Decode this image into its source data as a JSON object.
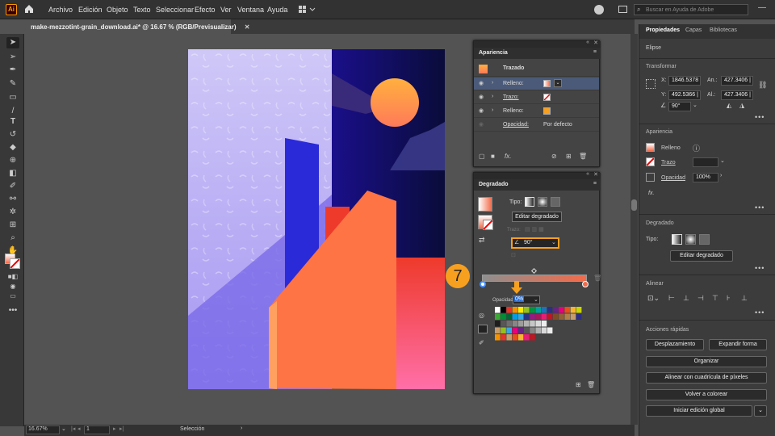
{
  "app": {
    "logo": "Ai"
  },
  "menu": [
    "Archivo",
    "Edición",
    "Objeto",
    "Texto",
    "Seleccionar",
    "Efecto",
    "Ver",
    "Ventana",
    "Ayuda"
  ],
  "search": {
    "placeholder": "Buscar en Ayuda de Adobe"
  },
  "document": {
    "tab_title": "make-mezzotint-grain_download.ai* @ 16.67 % (RGB/Previsualizar)"
  },
  "status": {
    "zoom": "16.67%",
    "artboard": "1",
    "tool": "Selección"
  },
  "right_panel": {
    "tabs": [
      "Propiedades",
      "Capas",
      "Bibliotecas"
    ],
    "object_type": "Elipse",
    "transform": {
      "title": "Transformar",
      "x_label": "X:",
      "x": "1846.5378",
      "y_label": "Y:",
      "y": "492.5366 |",
      "w_label": "An.:",
      "w": "427.3406 |",
      "h_label": "Al.:",
      "h": "427.3406 |",
      "angle": "90°"
    },
    "appearance": {
      "title": "Apariencia",
      "fill": "Relleno",
      "stroke": "Trazo",
      "opacity_label": "Opacidad",
      "opacity": "100%",
      "fx": "fx."
    },
    "gradient": {
      "title": "Degradado",
      "type_label": "Tipo:",
      "edit_button": "Editar degradado"
    },
    "align": {
      "title": "Alinear"
    },
    "quick_actions": {
      "title": "Acciones rápidas",
      "buttons": [
        "Desplazamiento",
        "Expandir forma",
        "Organizar",
        "Alinear con cuadrícula de píxeles",
        "Volver a colorear",
        "Iniciar edición global"
      ]
    }
  },
  "appearance_panel": {
    "title": "Apariencia",
    "object_label": "Trazado",
    "rows": [
      {
        "label": "Relleno:"
      },
      {
        "label": "Trazo:"
      },
      {
        "label": "Relleno:"
      }
    ],
    "opacity_label": "Opacidad:",
    "opacity_value": "Por defecto"
  },
  "gradient_panel": {
    "title": "Degradado",
    "type_label": "Tipo:",
    "edit_button": "Editar degradado",
    "stroke_label": "Trazo:",
    "angle_value": "90°",
    "opacity_label": "Opacidad:",
    "opacity_value": "0%"
  },
  "annotation": {
    "step": "7"
  },
  "colors": {
    "accent": "#f7a020",
    "gradient_start": "#ffffff",
    "gradient_end": "#f26b4a"
  }
}
